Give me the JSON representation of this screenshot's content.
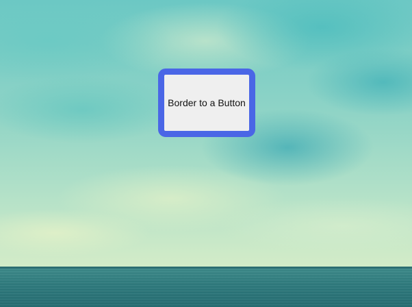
{
  "page": {
    "background": "sky-and-sea-image"
  },
  "button": {
    "label": "Border to a Button",
    "border_color": "#4a66e6",
    "background_color": "#efefef"
  }
}
